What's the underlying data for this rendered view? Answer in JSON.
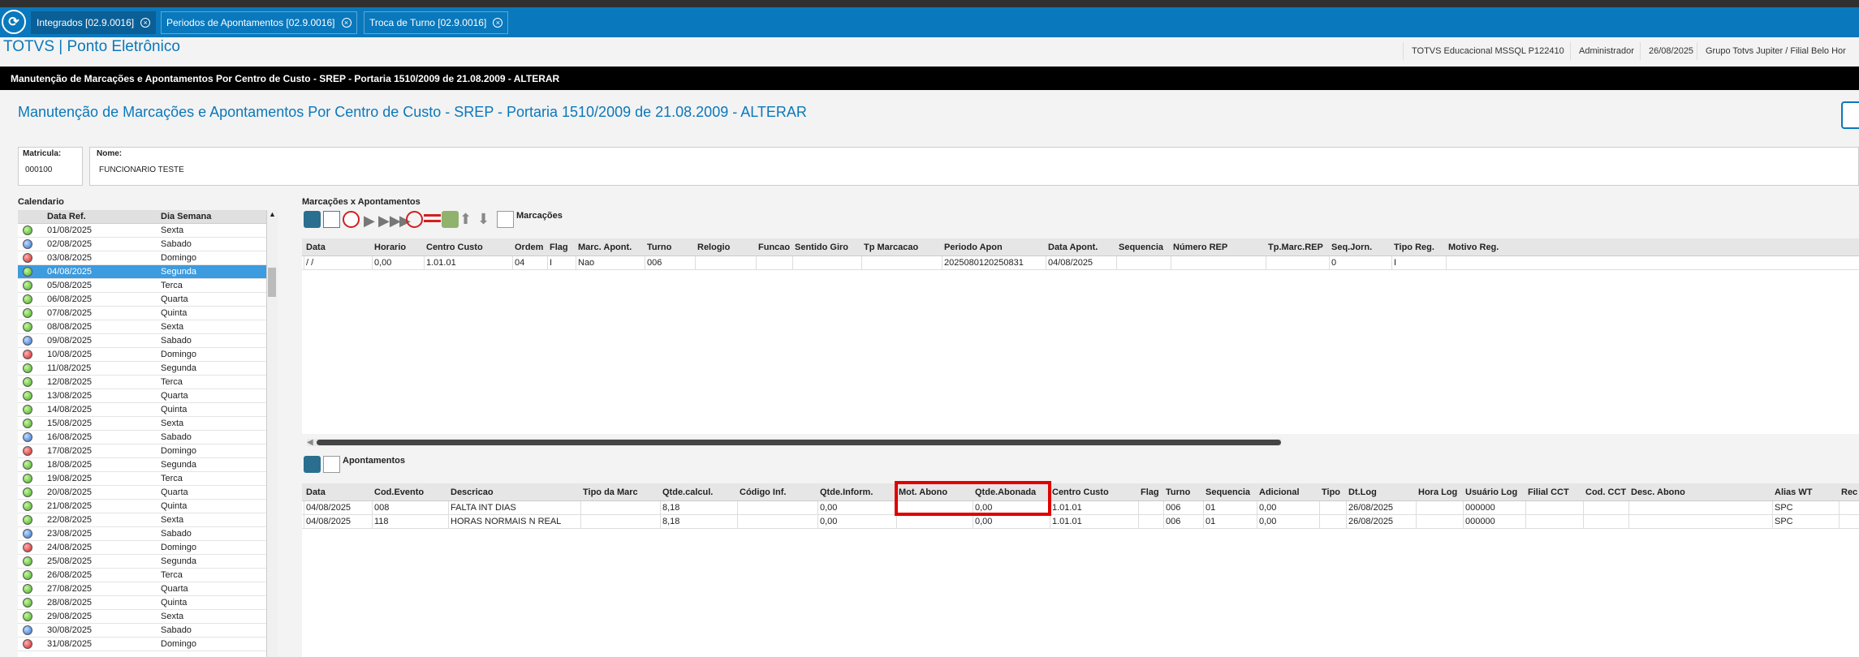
{
  "tabs": [
    {
      "label": "Integrados [02.9.0016]",
      "active": true
    },
    {
      "label": "Periodos de Apontamentos [02.9.0016]",
      "active": false
    },
    {
      "label": "Troca de Turno [02.9.0016]",
      "active": false
    }
  ],
  "app_title": "TOTVS | Ponto Eletrônico",
  "header_info": {
    "environment": "TOTVS Educacional MSSQL P122410",
    "user": "Administrador",
    "date": "26/08/2025",
    "company": "Grupo Totvs Jupiter / Filial Belo Hor"
  },
  "window_title": "Manutenção de Marcações e Apontamentos Por Centro de Custo - SREP - Portaria 1510/2009 de 21.08.2009 - ALTERAR",
  "page_title": "Manutenção de Marcações e Apontamentos Por Centro de Custo - SREP - Portaria 1510/2009 de 21.08.2009 - ALTERAR",
  "fields": {
    "matricula_label": "Matricula:",
    "matricula_value": "000100",
    "nome_label": "Nome:",
    "nome_value": "FUNCIONARIO TESTE"
  },
  "calendar": {
    "title": "Calendario",
    "col_date": "Data Ref.",
    "col_day": "Dia Semana",
    "rows": [
      {
        "date": "01/08/2025",
        "day": "Sexta",
        "status": "green"
      },
      {
        "date": "02/08/2025",
        "day": "Sabado",
        "status": "blue"
      },
      {
        "date": "03/08/2025",
        "day": "Domingo",
        "status": "red"
      },
      {
        "date": "04/08/2025",
        "day": "Segunda",
        "status": "green",
        "selected": true
      },
      {
        "date": "05/08/2025",
        "day": "Terca",
        "status": "green"
      },
      {
        "date": "06/08/2025",
        "day": "Quarta",
        "status": "green"
      },
      {
        "date": "07/08/2025",
        "day": "Quinta",
        "status": "green"
      },
      {
        "date": "08/08/2025",
        "day": "Sexta",
        "status": "green"
      },
      {
        "date": "09/08/2025",
        "day": "Sabado",
        "status": "blue"
      },
      {
        "date": "10/08/2025",
        "day": "Domingo",
        "status": "red"
      },
      {
        "date": "11/08/2025",
        "day": "Segunda",
        "status": "green"
      },
      {
        "date": "12/08/2025",
        "day": "Terca",
        "status": "green"
      },
      {
        "date": "13/08/2025",
        "day": "Quarta",
        "status": "green"
      },
      {
        "date": "14/08/2025",
        "day": "Quinta",
        "status": "green"
      },
      {
        "date": "15/08/2025",
        "day": "Sexta",
        "status": "green"
      },
      {
        "date": "16/08/2025",
        "day": "Sabado",
        "status": "blue"
      },
      {
        "date": "17/08/2025",
        "day": "Domingo",
        "status": "red"
      },
      {
        "date": "18/08/2025",
        "day": "Segunda",
        "status": "green"
      },
      {
        "date": "19/08/2025",
        "day": "Terca",
        "status": "green"
      },
      {
        "date": "20/08/2025",
        "day": "Quarta",
        "status": "green"
      },
      {
        "date": "21/08/2025",
        "day": "Quinta",
        "status": "green"
      },
      {
        "date": "22/08/2025",
        "day": "Sexta",
        "status": "green"
      },
      {
        "date": "23/08/2025",
        "day": "Sabado",
        "status": "blue"
      },
      {
        "date": "24/08/2025",
        "day": "Domingo",
        "status": "red"
      },
      {
        "date": "25/08/2025",
        "day": "Segunda",
        "status": "green"
      },
      {
        "date": "26/08/2025",
        "day": "Terca",
        "status": "green"
      },
      {
        "date": "27/08/2025",
        "day": "Quarta",
        "status": "green"
      },
      {
        "date": "28/08/2025",
        "day": "Quinta",
        "status": "green"
      },
      {
        "date": "29/08/2025",
        "day": "Sexta",
        "status": "green"
      },
      {
        "date": "30/08/2025",
        "day": "Sabado",
        "status": "blue"
      },
      {
        "date": "31/08/2025",
        "day": "Domingo",
        "status": "red"
      }
    ]
  },
  "marcacoes": {
    "section_title": "Marcações x Apontamentos",
    "toolbar_label": "Marcações",
    "columns": [
      "Data",
      "Horario",
      "Centro Custo",
      "Ordem",
      "Flag",
      "Marc. Apont.",
      "Turno",
      "Relogio",
      "Funcao",
      "Sentido Giro",
      "Tp Marcacao",
      "Periodo Apon",
      "Data Apont.",
      "Sequencia",
      "Número REP",
      "Tp.Marc.REP",
      "Seq.Jorn.",
      "Tipo Reg.",
      "Motivo Reg."
    ],
    "rows": [
      [
        "/ /",
        "0,00",
        "1.01.01",
        "04",
        "I",
        "Nao",
        "006",
        "",
        "",
        "",
        "",
        "2025080120250831",
        "04/08/2025",
        "",
        "",
        "",
        "0",
        "I",
        ""
      ]
    ]
  },
  "apontamentos": {
    "toolbar_label": "Apontamentos",
    "columns": [
      "Data",
      "Cod.Evento",
      "Descricao",
      "Tipo da Marc",
      "Qtde.calcul.",
      "Código Inf.",
      "Qtde.Inform.",
      "Mot. Abono",
      "Qtde.Abonada",
      "Centro Custo",
      "Flag",
      "Turno",
      "Sequencia",
      "Adicional",
      "Tipo",
      "Dt.Log",
      "Hora Log",
      "Usuário Log",
      "Filial CCT",
      "Cod. CCT",
      "Desc. Abono",
      "Alias WT",
      "Rec"
    ],
    "rows": [
      [
        "04/08/2025",
        "008",
        "FALTA INT DIAS",
        "",
        "8,18",
        "",
        "0,00",
        "",
        "0,00",
        "1.01.01",
        "",
        "006",
        "01",
        "0,00",
        "",
        "26/08/2025",
        "",
        "000000",
        "",
        "",
        "",
        "SPC",
        ""
      ],
      [
        "04/08/2025",
        "118",
        "HORAS NORMAIS N REAL",
        "",
        "8,18",
        "",
        "0,00",
        "",
        "0,00",
        "1.01.01",
        "",
        "006",
        "01",
        "0,00",
        "",
        "26/08/2025",
        "",
        "000000",
        "",
        "",
        "",
        "SPC",
        ""
      ]
    ]
  },
  "colors": {
    "brand": "#0a78bc",
    "selection": "#3d9bdf",
    "highlight": "#e00000"
  }
}
